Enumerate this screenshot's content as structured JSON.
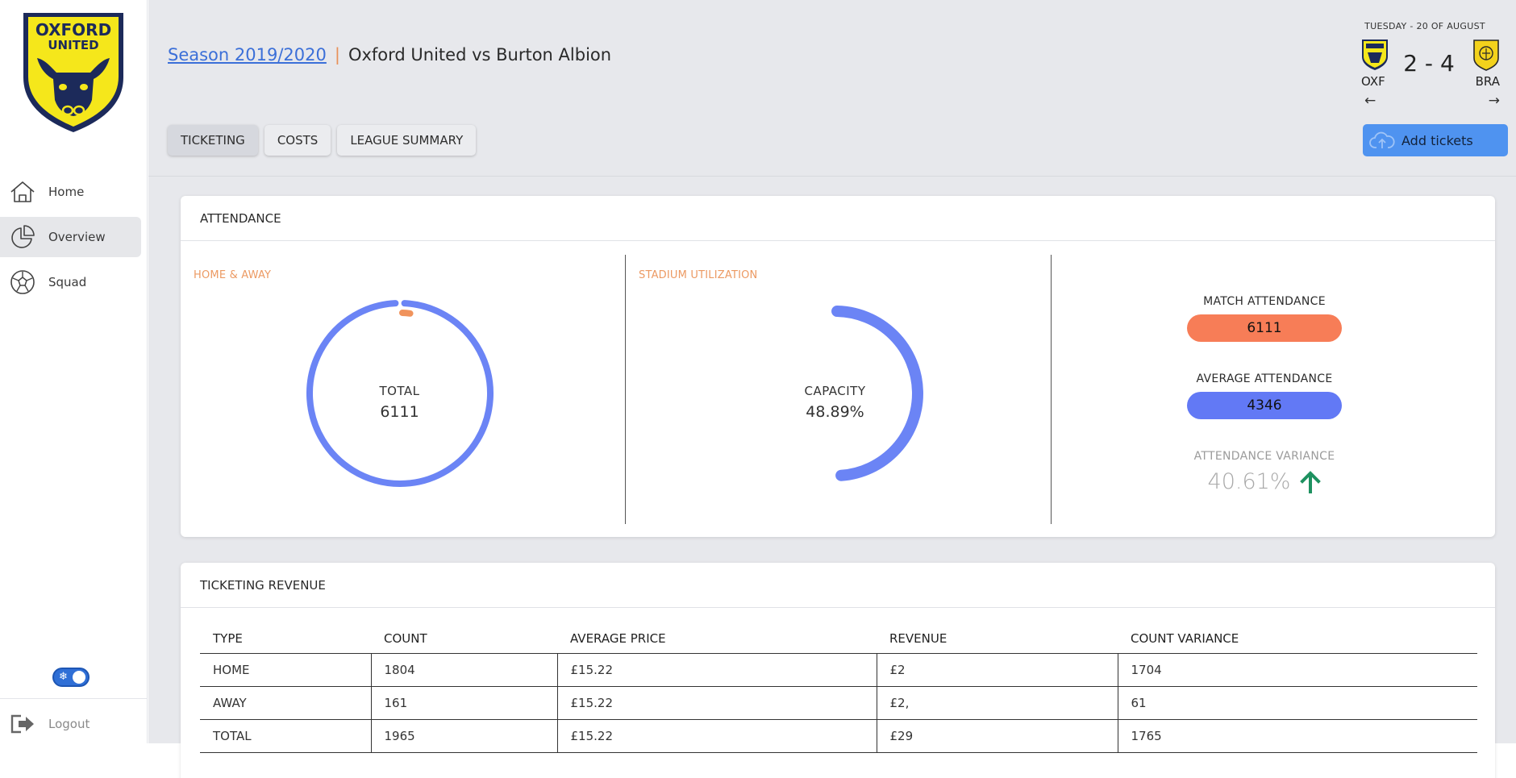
{
  "brand": {
    "crest_text_line1": "OXFORD",
    "crest_text_line2": "UNITED",
    "crest_color": "#f5e71b",
    "crest_navy": "#1c2a5a"
  },
  "sidebar": {
    "items": [
      {
        "label": "Home",
        "icon": "home-icon"
      },
      {
        "label": "Overview",
        "icon": "pie-chart-icon"
      },
      {
        "label": "Squad",
        "icon": "football-icon"
      }
    ],
    "theme_toggle_glyph": "❄",
    "logout_label": "Logout"
  },
  "header": {
    "season_link": "Season 2019/2020",
    "separator": "|",
    "match_title": "Oxford United vs Burton Albion",
    "tabs": [
      "TICKETING",
      "COSTS",
      "LEAGUE SUMMARY"
    ],
    "add_tickets_label": "Add tickets",
    "scoreboard": {
      "date": "TUESDAY - 20 OF AUGUST",
      "score": "2 - 4",
      "home_code": "OXF",
      "away_code": "BRA",
      "prev_arrow": "←",
      "next_arrow": "→"
    }
  },
  "attendance": {
    "title": "ATTENDANCE",
    "home_away": {
      "label": "HOME & AWAY",
      "center_label": "TOTAL",
      "center_value": "6111",
      "home_value": 1804,
      "away_value": 161,
      "home_color": "#6b84f5",
      "away_color": "#f0935c"
    },
    "utilization": {
      "label": "STADIUM UTILIZATION",
      "center_label": "CAPACITY",
      "center_value": "48.89%",
      "percent": 48.89,
      "color": "#6b84f5"
    },
    "stats": {
      "match_label": "MATCH ATTENDANCE",
      "match_value": "6111",
      "match_color": "#f77d57",
      "average_label": "AVERAGE ATTENDANCE",
      "average_value": "4346",
      "average_color": "#6279f5",
      "variance_label": "ATTENDANCE VARIANCE",
      "variance_value": "40.61%",
      "variance_arrow_color": "#1e9160"
    }
  },
  "revenue": {
    "title": "TICKETING REVENUE",
    "columns": [
      "TYPE",
      "COUNT",
      "AVERAGE PRICE",
      "REVENUE",
      "COUNT VARIANCE"
    ],
    "rows": [
      [
        "HOME",
        "1804",
        "£15.22",
        "£2",
        "1704"
      ],
      [
        "AWAY",
        "161",
        "£15.22",
        "£2,",
        "61"
      ],
      [
        "TOTAL",
        "1965",
        "£15.22",
        "£29",
        "1765"
      ]
    ]
  }
}
